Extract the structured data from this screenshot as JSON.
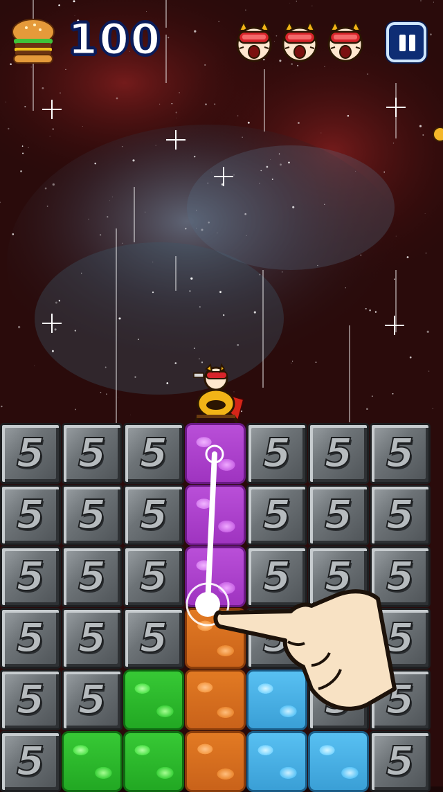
{
  "hud": {
    "score": "100",
    "lives": 3,
    "burger_icon": "burger-icon",
    "life_icon": "hero-head-icon",
    "pause_icon": "pause-icon"
  },
  "board": {
    "tile_number": "5",
    "rows": [
      [
        "steel",
        "steel",
        "steel",
        "purple",
        "steel",
        "steel",
        "steel"
      ],
      [
        "steel",
        "steel",
        "steel",
        "purple",
        "steel",
        "steel",
        "steel"
      ],
      [
        "steel",
        "steel",
        "steel",
        "purple",
        "steel",
        "steel",
        "steel"
      ],
      [
        "steel",
        "steel",
        "steel",
        "orange",
        "steel",
        "steel",
        "steel"
      ],
      [
        "steel",
        "steel",
        "green",
        "orange",
        "blue",
        "steel",
        "steel"
      ],
      [
        "steel",
        "green",
        "green",
        "orange",
        "blue",
        "blue",
        "steel"
      ]
    ]
  },
  "tutorial": {
    "hand_icon": "pointing-hand-icon",
    "gesture": "swipe-down"
  },
  "colors": {
    "background": "#2a0b0b",
    "score_outline": "#0a1c5a",
    "pause_fill": "#0e2d74"
  }
}
